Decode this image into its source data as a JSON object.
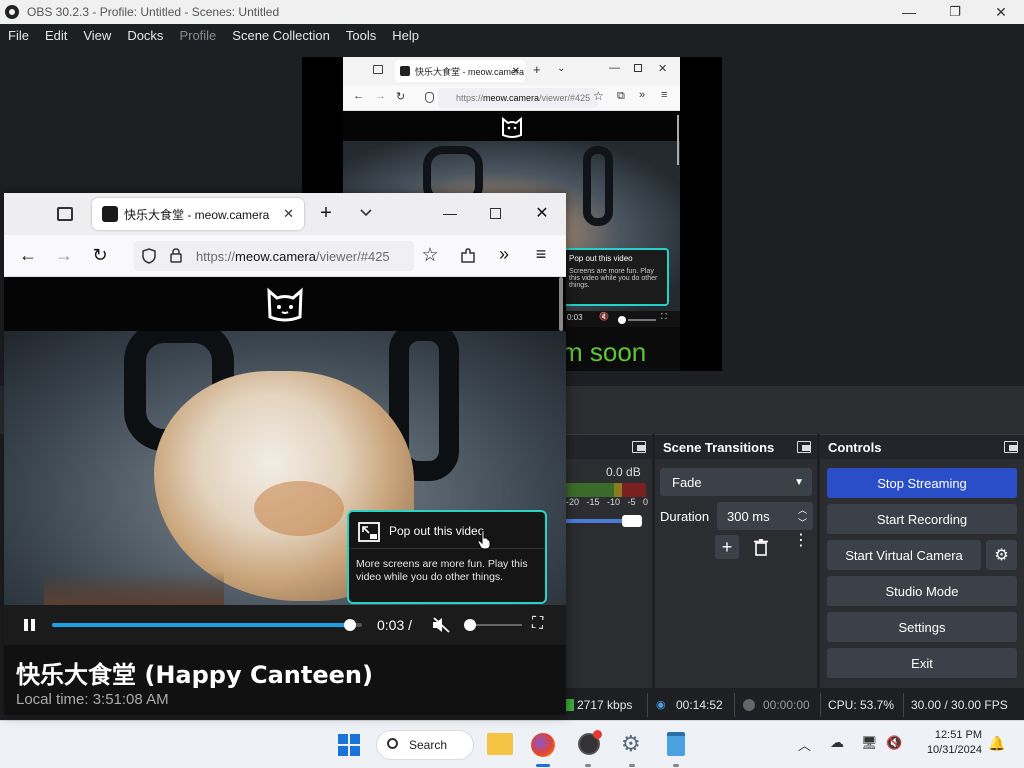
{
  "obs": {
    "title": "OBS 30.2.3 - Profile: Untitled - Scenes: Untitled",
    "menu": [
      "File",
      "Edit",
      "View",
      "Docks",
      "Profile",
      "Scene Collection",
      "Tools",
      "Help"
    ],
    "window_controls": {
      "minimize": "—",
      "maximize": "❐",
      "close": "✕"
    }
  },
  "mini_browser": {
    "tab_title": "快乐大食堂 - meow.camera",
    "url_prefix": "https://",
    "url_domain": "meow.camera",
    "url_rest": "/viewer/#425",
    "popup_title": "Pop out this video",
    "popup_body": "Screens are more fun. Play this video while you do other things.",
    "time": "0:03",
    "overlay_text": "m soon"
  },
  "audio_mixer": {
    "level": "0.0 dB",
    "meter_labels": [
      "-20",
      "-15",
      "-10",
      "-5",
      "0"
    ]
  },
  "scene_transitions": {
    "title": "Scene Transitions",
    "transition": "Fade",
    "duration_label": "Duration",
    "duration_value": "300 ms"
  },
  "controls": {
    "title": "Controls",
    "stop_streaming": "Stop Streaming",
    "start_recording": "Start Recording",
    "start_virtual_camera": "Start Virtual Camera",
    "studio_mode": "Studio Mode",
    "settings": "Settings",
    "exit": "Exit"
  },
  "status": {
    "bitrate": "2717 kbps",
    "stream_time": "00:14:52",
    "record_time": "00:00:00",
    "cpu": "CPU: 53.7%",
    "fps": "30.00 / 30.00 FPS"
  },
  "browser": {
    "tab_title": "快乐大食堂 - meow.camera",
    "url_prefix": "https://",
    "url_domain": "meow.camera",
    "url_rest": "/viewer/#425",
    "popout_title": "Pop out this video",
    "popout_body": "More screens are more fun. Play this video while you do other things.",
    "time": "0:03 /",
    "progress": 0.96,
    "volume": 0.0,
    "stream_title": "快乐大食堂 (Happy Canteen)",
    "local_time": "Local time: 3:51:08 AM"
  },
  "taskbar": {
    "search_label": "Search",
    "clock_time": "12:51 PM",
    "clock_date": "10/31/2024"
  },
  "colors": {
    "obs_bg": "#1e1f22",
    "obs_panel": "#2b2d31",
    "stream_button": "#2a4dc8",
    "accent_teal": "#26d3c8",
    "progress_blue": "#1ea0e6",
    "soon_green": "#5ec43a"
  }
}
